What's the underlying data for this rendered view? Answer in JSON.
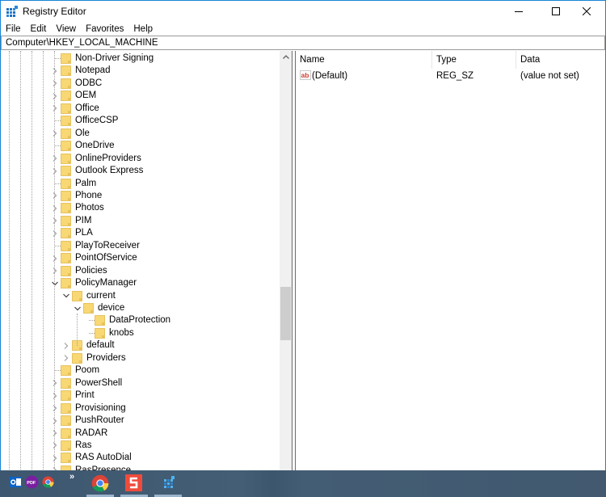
{
  "window": {
    "title": "Registry Editor",
    "controls": {
      "minimize": "minimize",
      "maximize": "maximize",
      "close": "close"
    }
  },
  "menu": [
    "File",
    "Edit",
    "View",
    "Favorites",
    "Help"
  ],
  "address": "Computer\\HKEY_LOCAL_MACHINE",
  "tree": [
    {
      "label": "Non-Driver Signing",
      "level": 0,
      "state": "leaf"
    },
    {
      "label": "Notepad",
      "level": 0,
      "state": "collapsed"
    },
    {
      "label": "ODBC",
      "level": 0,
      "state": "collapsed"
    },
    {
      "label": "OEM",
      "level": 0,
      "state": "collapsed"
    },
    {
      "label": "Office",
      "level": 0,
      "state": "collapsed"
    },
    {
      "label": "OfficeCSP",
      "level": 0,
      "state": "leaf"
    },
    {
      "label": "Ole",
      "level": 0,
      "state": "collapsed"
    },
    {
      "label": "OneDrive",
      "level": 0,
      "state": "leaf"
    },
    {
      "label": "OnlineProviders",
      "level": 0,
      "state": "collapsed"
    },
    {
      "label": "Outlook Express",
      "level": 0,
      "state": "collapsed"
    },
    {
      "label": "Palm",
      "level": 0,
      "state": "leaf"
    },
    {
      "label": "Phone",
      "level": 0,
      "state": "collapsed"
    },
    {
      "label": "Photos",
      "level": 0,
      "state": "collapsed"
    },
    {
      "label": "PIM",
      "level": 0,
      "state": "collapsed"
    },
    {
      "label": "PLA",
      "level": 0,
      "state": "collapsed"
    },
    {
      "label": "PlayToReceiver",
      "level": 0,
      "state": "leaf"
    },
    {
      "label": "PointOfService",
      "level": 0,
      "state": "collapsed"
    },
    {
      "label": "Policies",
      "level": 0,
      "state": "collapsed"
    },
    {
      "label": "PolicyManager",
      "level": 0,
      "state": "expanded"
    },
    {
      "label": "current",
      "level": 1,
      "state": "expanded"
    },
    {
      "label": "device",
      "level": 2,
      "state": "expanded"
    },
    {
      "label": "DataProtection",
      "level": 3,
      "state": "leaf"
    },
    {
      "label": "knobs",
      "level": 3,
      "state": "leaf"
    },
    {
      "label": "default",
      "level": 1,
      "state": "collapsed"
    },
    {
      "label": "Providers",
      "level": 1,
      "state": "collapsed"
    },
    {
      "label": "Poom",
      "level": 0,
      "state": "leaf"
    },
    {
      "label": "PowerShell",
      "level": 0,
      "state": "collapsed"
    },
    {
      "label": "Print",
      "level": 0,
      "state": "collapsed"
    },
    {
      "label": "Provisioning",
      "level": 0,
      "state": "collapsed"
    },
    {
      "label": "PushRouter",
      "level": 0,
      "state": "collapsed"
    },
    {
      "label": "RADAR",
      "level": 0,
      "state": "collapsed"
    },
    {
      "label": "Ras",
      "level": 0,
      "state": "collapsed"
    },
    {
      "label": "RAS AutoDial",
      "level": 0,
      "state": "collapsed"
    },
    {
      "label": "RasPresence",
      "level": 0,
      "state": "collapsed"
    }
  ],
  "list": {
    "columns": {
      "name": "Name",
      "type": "Type",
      "data": "Data"
    },
    "rows": [
      {
        "name": "(Default)",
        "type": "REG_SZ",
        "data": "(value not set)",
        "icon": "string-value-icon"
      }
    ]
  },
  "scrollbar": {
    "position_fraction": 0.56
  },
  "taskbar": {
    "quick_launch": [
      "outlook-icon",
      "pdf-icon",
      "chrome-small-icon"
    ],
    "overflow": "»",
    "apps": [
      "chrome-icon",
      "snagit-icon",
      "registry-editor-taskbar-icon"
    ]
  },
  "colors": {
    "window_border": "#1883d7",
    "folder": "#f7d77a",
    "taskbar": "#435d74",
    "ab_red": "#d33a2c"
  }
}
